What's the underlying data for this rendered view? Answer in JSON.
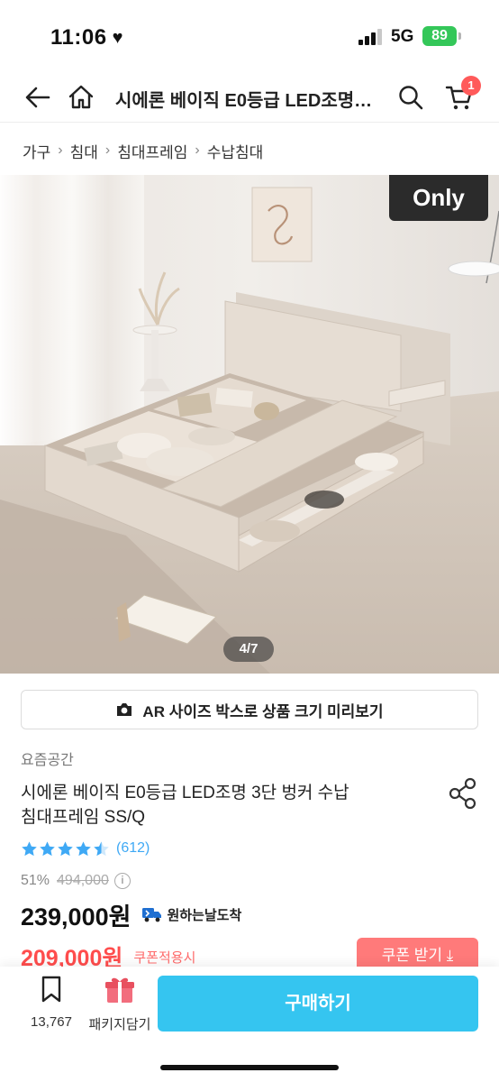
{
  "status_bar": {
    "time": "11:06",
    "network": "5G",
    "battery": "89"
  },
  "header": {
    "title": "시에론 베이직 E0등급 LED조명 3단 벙커 수납 침대프레임 SS/Q",
    "cart_count": "1"
  },
  "breadcrumb": [
    "가구",
    "침대",
    "침대프레임",
    "수납침대"
  ],
  "hero": {
    "badge": "Only",
    "page_indicator": "4/7"
  },
  "ar_button": {
    "label": "AR 사이즈 박스로 상품 크기 미리보기"
  },
  "product": {
    "brand": "요즘공간",
    "title_line1": "시에론 베이직 E0등급 LED조명 3단 벙커 수납",
    "title_line2": "침대프레임 SS/Q",
    "rating": 4.5,
    "review_count": "(612)",
    "discount_rate": "51%",
    "original_price": "494,000",
    "sale_price": "239,000원",
    "delivery_label": "원하는날도착",
    "coupon_price": "209,000원",
    "coupon_label": "쿠폰적용시",
    "coupon_button": "쿠폰 받기"
  },
  "bottom_bar": {
    "bookmark_count": "13,767",
    "package_label": "패키지담기",
    "buy_label": "구매하기"
  },
  "colors": {
    "accent": "#35c5f0",
    "price_red": "#ff4d4d",
    "coupon_button": "#ff7a7a",
    "star": "#3fa9f5",
    "battery": "#34c759"
  }
}
